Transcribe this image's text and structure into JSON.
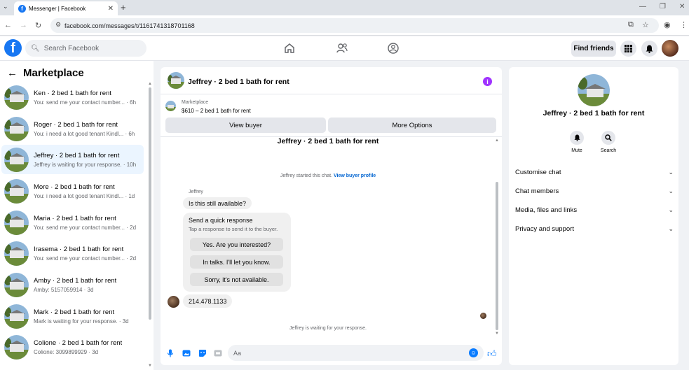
{
  "browser": {
    "tab_title": "Messenger | Facebook",
    "tab_close": "✕",
    "new_tab": "+",
    "url": "facebook.com/messages/t/1161741318701168"
  },
  "fb": {
    "search_placeholder": "Search Facebook",
    "find_friends": "Find friends",
    "logo_letter": "f"
  },
  "left": {
    "title": "Marketplace",
    "conversations": [
      {
        "name": "Ken · 2 bed 1 bath for rent",
        "sub": "You: send me your contact number... · 6h"
      },
      {
        "name": "Roger · 2 bed 1 bath for rent",
        "sub": "You: i need a lot good tenant Kindl... · 6h"
      },
      {
        "name": "Jeffrey · 2 bed 1 bath for rent",
        "sub": "Jeffrey is waiting for your response. · 10h"
      },
      {
        "name": "More · 2 bed 1 bath for rent",
        "sub": "You: i need a lot good tenant Kindl... · 1d"
      },
      {
        "name": "Maria · 2 bed 1 bath for rent",
        "sub": "You: send me your contact number... · 2d"
      },
      {
        "name": "Irasema · 2 bed 1 bath for rent",
        "sub": "You: send me your contact number... · 2d"
      },
      {
        "name": "Amby · 2 bed 1 bath for rent",
        "sub": "Amby: 5157059914 · 3d"
      },
      {
        "name": "Mark · 2 bed 1 bath for rent",
        "sub": "Mark is waiting for your response. · 3d"
      },
      {
        "name": "Colione · 2 bed 1 bath for rent",
        "sub": "Colione: 3099899929 · 3d"
      }
    ]
  },
  "chat": {
    "title": "Jeffrey · 2 bed 1 bath for rent",
    "marketplace_label": "Marketplace",
    "price_line": "$610 – 2 bed 1 bath for rent",
    "view_buyer": "View buyer",
    "more_options": "More Options",
    "thread_title": "Jeffrey · 2 bed 1 bath for rent",
    "started_text": "Jeffrey started this chat.",
    "view_profile": "View buyer profile",
    "sender_name": "Jeffrey",
    "first_message": "Is this still available?",
    "quick_title": "Send a quick response",
    "quick_sub": "Tap a response to send it to the buyer.",
    "quick_options": [
      "Yes. Are you interested?",
      "In talks. I'll let you know.",
      "Sorry, it's not available."
    ],
    "phone_message": "214.478.1133",
    "waiting_text": "Jeffrey is waiting for your response.",
    "input_placeholder": "Aa"
  },
  "right": {
    "title": "Jeffrey · 2 bed 1 bath for rent",
    "mute_label": "Mute",
    "search_label": "Search",
    "sections": [
      "Customise chat",
      "Chat members",
      "Media, files and links",
      "Privacy and support"
    ]
  },
  "colors": {
    "brand": "#1877f2",
    "accent": "#0a7cff",
    "info": "#a033ff",
    "active_row": "#ebf5ff"
  }
}
